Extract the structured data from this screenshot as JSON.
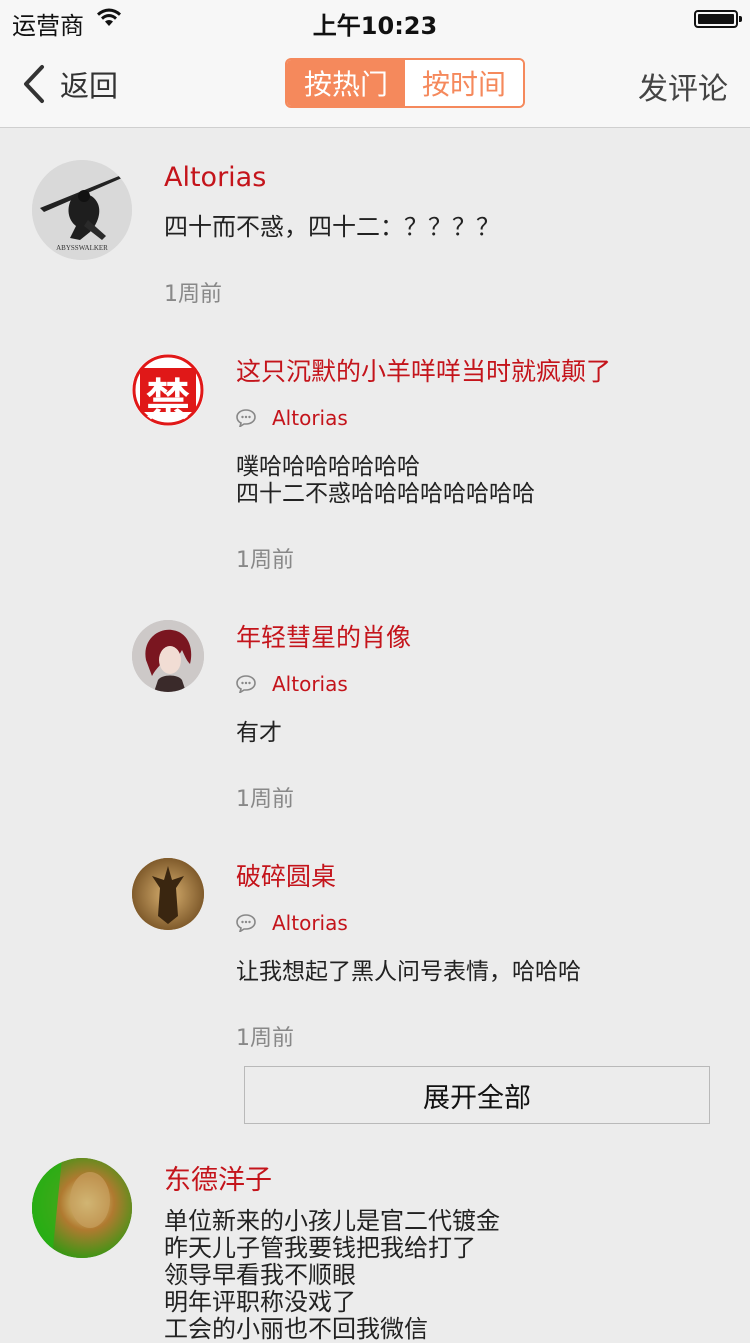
{
  "status": {
    "carrier": "运营商",
    "time": "上午10:23"
  },
  "nav": {
    "back_label": "返回",
    "tab_hot": "按热门",
    "tab_time": "按时间",
    "compose_label": "发评论"
  },
  "comments": [
    {
      "user": "Altorias",
      "avatar_text": "ABYSSWALKER",
      "text": "四十而不惑，四十二：？？？？",
      "time": "1周前",
      "replies": [
        {
          "user": "这只沉默的小羊咩咩当时就疯颠了",
          "avatar_text": "禁",
          "reply_to": "Altorias",
          "text": "噗哈哈哈哈哈哈哈\n四十二不惑哈哈哈哈哈哈哈哈",
          "time": "1周前"
        },
        {
          "user": "年轻彗星的肖像",
          "reply_to": "Altorias",
          "text": "有才",
          "time": "1周前"
        },
        {
          "user": "破碎圆桌",
          "reply_to": "Altorias",
          "text": "让我想起了黑人问号表情，哈哈哈",
          "time": "1周前"
        }
      ],
      "expand_label": "展开全部"
    },
    {
      "user": "东德洋子",
      "text": "单位新来的小孩儿是官二代镀金\n昨天儿子管我要钱把我给打了\n领导早看我不顺眼\n明年评职称没戏了\n工会的小丽也不回我微信"
    }
  ],
  "colors": {
    "accent": "#f5895c",
    "username": "#c4141b",
    "background": "#ececec"
  }
}
